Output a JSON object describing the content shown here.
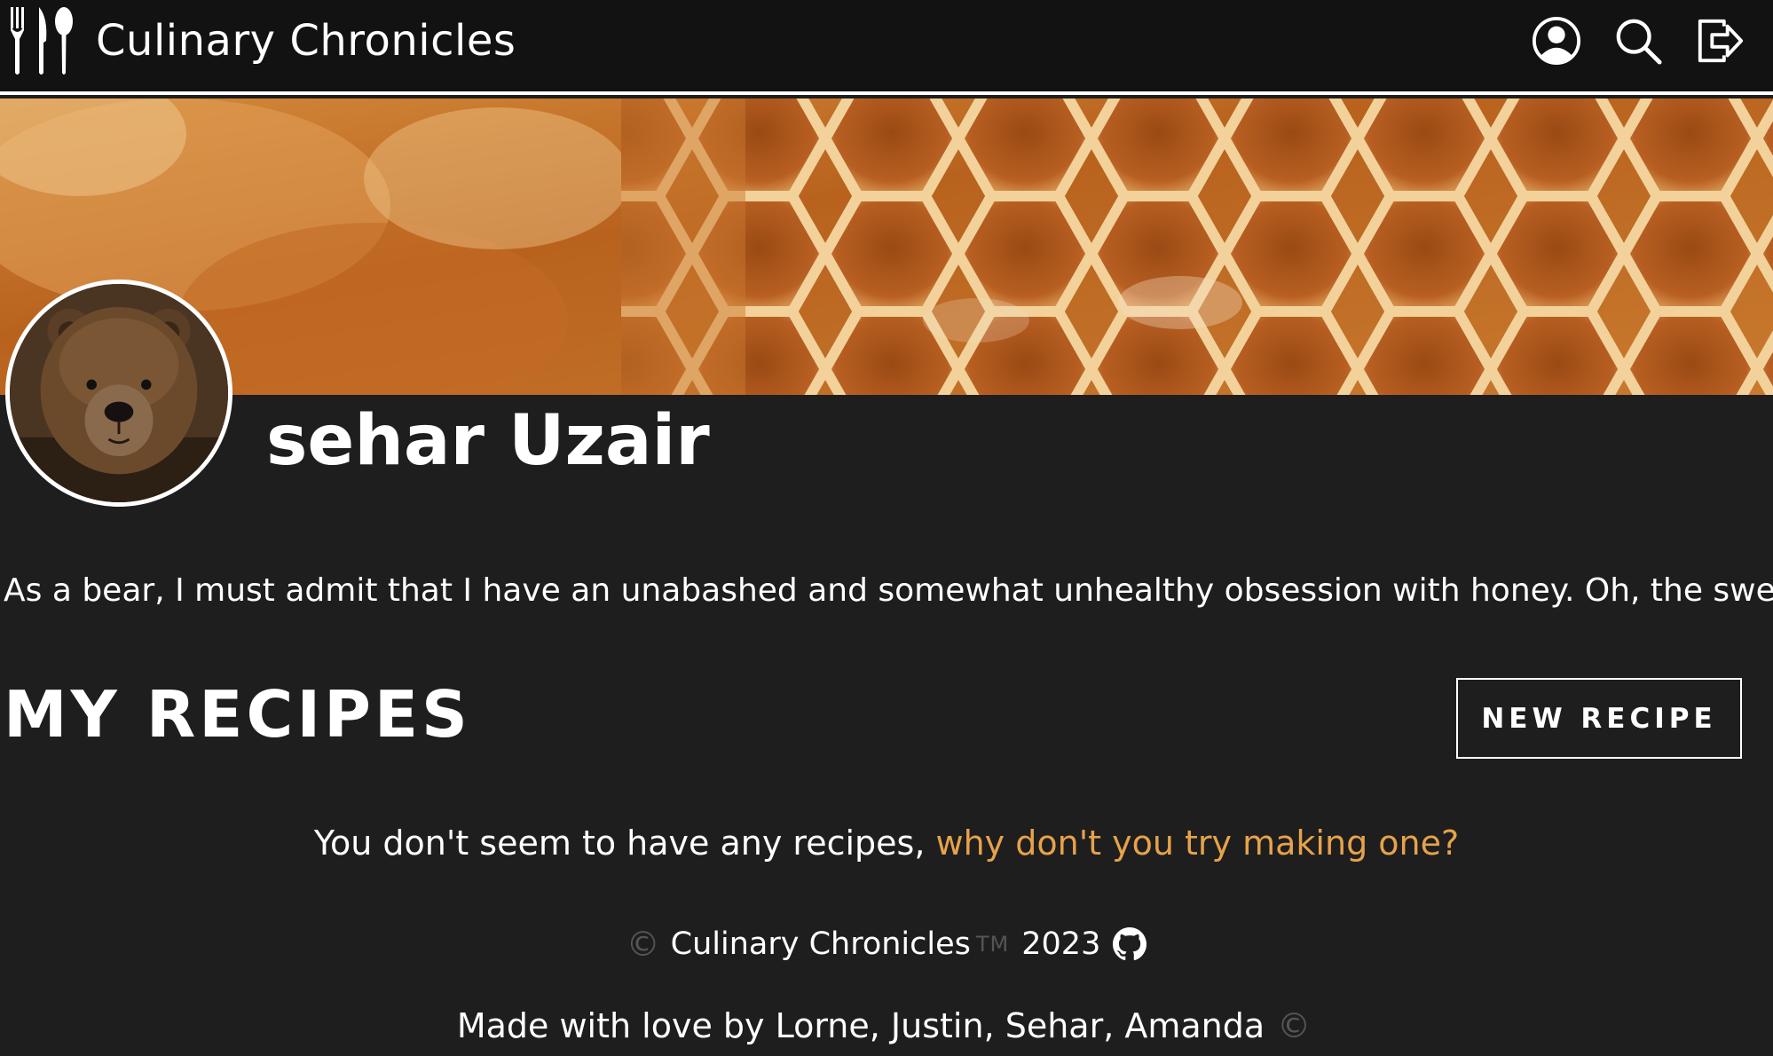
{
  "header": {
    "brand_title": "Culinary Chronicles",
    "brand_icon": "fork-knife-spoon-icon",
    "icons": [
      "profile-icon",
      "search-icon",
      "logout-icon"
    ]
  },
  "profile": {
    "name": "sehar Uzair",
    "bio": "As a bear, I must admit that I have an unabashed and somewhat unhealthy obsession with honey. Oh, the sweet, golden necta"
  },
  "recipes": {
    "heading": "MY RECIPES",
    "new_button_label": "NEW RECIPE",
    "empty_text": "You don't seem to have any recipes, ",
    "empty_link": "why don't you try making one?"
  },
  "footer": {
    "copyright_symbol": "©",
    "brand": "Culinary Chronicles",
    "trademark": "TM",
    "year": "2023",
    "credits": "Made with love by Lorne, Justin, Sehar, Amanda",
    "credits_symbol": "©"
  },
  "colors": {
    "nav_background": "#121212",
    "page_background": "#1e1e1e",
    "link_accent": "#e6a24a",
    "muted_symbol": "#555555"
  }
}
